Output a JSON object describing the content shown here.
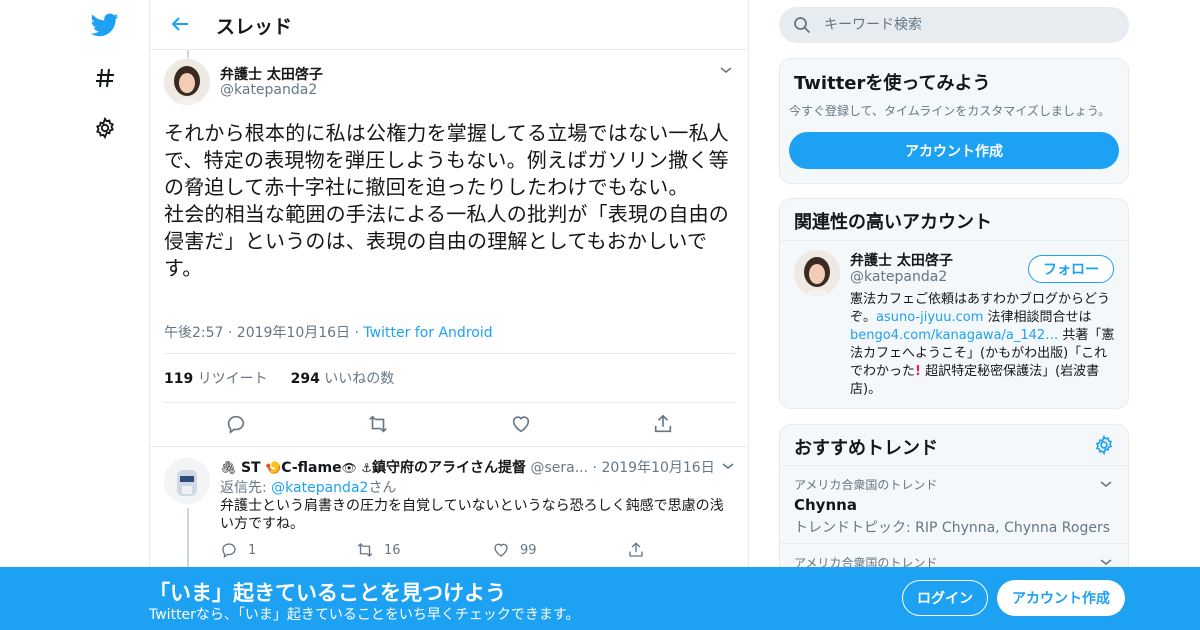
{
  "nav": {
    "logo_icon": "twitter-bird-icon",
    "explore_icon": "hashtag-icon",
    "settings_icon": "gear-icon"
  },
  "header": {
    "title": "スレッド",
    "back_icon": "back-arrow-icon"
  },
  "tweet": {
    "name": "弁護士 太田啓子",
    "handle": "@katepanda2",
    "text": "それから根本的に私は公権力を掌握してる立場ではない一私人で、特定の表現物を弾圧しようもない。例えばガソリン撒く等の脅迫して赤十字社に撤回を迫ったりしたわけでもない。\n社会的相当な範囲の手法による一私人の批判が「表現の自由の侵害だ」というのは、表現の自由の理解としてもおかしいです。",
    "time": "午後2:57 · 2019年10月16日",
    "dot": " · ",
    "source": "Twitter for Android",
    "retweets": "119",
    "retweets_label": "リツイート",
    "likes": "294",
    "likes_label": "いいねの数"
  },
  "reply": {
    "name_prefix": "ST",
    "name_middle": "C-flame",
    "name_suffix": "鎮守府のアライさん提督",
    "handle": "@sera...",
    "dot": " · ",
    "date": "2019年10月16日",
    "reply_to_label": "返信先: ",
    "reply_to_handle": "@katepanda2",
    "reply_to_suffix": "さん",
    "text": "弁護士という肩書きの圧力を自覚していないというなら恐ろしく鈍感で思慮の浅い方ですね。",
    "replies": "1",
    "retweets": "16",
    "likes": "99"
  },
  "search": {
    "placeholder": "キーワード検索"
  },
  "try_twitter": {
    "title": "Twitterを使ってみよう",
    "subtitle": "今すぐ登録して、タイムラインをカスタマイズしましょう。",
    "button": "アカウント作成"
  },
  "related": {
    "title": "関連性の高いアカウント",
    "name": "弁護士 太田啓子",
    "handle": "@katepanda2",
    "follow": "フォロー",
    "bio_1": "憲法カフェご依頼はあすわかブログからどうぞ。",
    "bio_link1": "asuno-jiyuu.com",
    "bio_2": " 法律相談問合せは",
    "bio_link2": "bengo4.com/kanagawa/a_142…",
    "bio_3": " 共著「憲法カフェへようこそ」(かもがわ出版)「これでわかった",
    "bio_4": " 超訳特定秘密保護法」(岩波書店)。"
  },
  "trends": {
    "title": "おすすめトレンド",
    "items": [
      {
        "context": "アメリカ合衆国のトレンド",
        "name": "Chynna",
        "topic": "トレンドトピック: RIP Chynna, Chynna Rogers"
      },
      {
        "context": "アメリカ合衆国のトレンド"
      }
    ]
  },
  "bottom": {
    "title": "「いま」起きていることを見つけよう",
    "subtitle": "Twitterなら、「いま」起きていることをいち早くチェックできます。",
    "login": "ログイン",
    "signup": "アカウント作成"
  },
  "colors": {
    "brand": "#1da1f2",
    "text": "#14171a",
    "secondary": "#657786",
    "border": "#e6ecf0"
  }
}
